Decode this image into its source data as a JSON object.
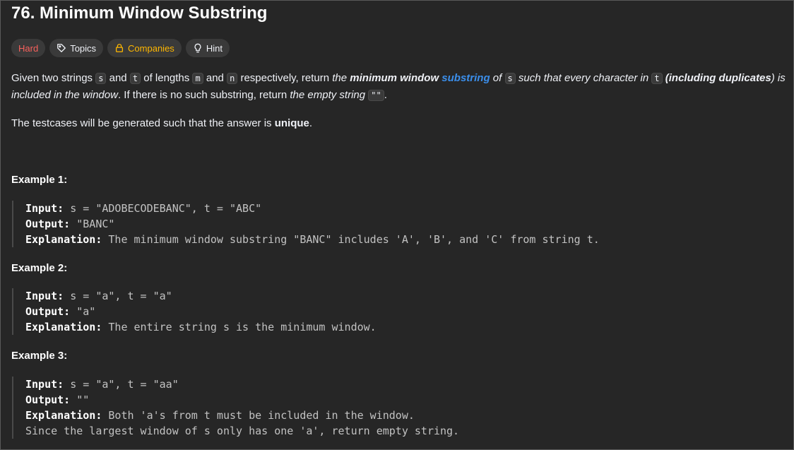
{
  "problem": {
    "title": "76. Minimum Window Substring"
  },
  "tags": {
    "difficulty": "Hard",
    "topics": "Topics",
    "companies": "Companies",
    "hint": "Hint"
  },
  "description": {
    "p1_a": "Given two strings ",
    "p1_s": "s",
    "p1_b": " and ",
    "p1_t": "t",
    "p1_c": " of lengths ",
    "p1_m": "m",
    "p1_d": " and ",
    "p1_n": "n",
    "p1_e": " respectively, return ",
    "p1_f": "the ",
    "p1_g": "minimum window",
    "p1_link": "substring",
    "p1_h": " of ",
    "p1_s2": "s",
    "p1_i": " such that every character in ",
    "p1_t2": "t",
    "p1_j": " (",
    "p1_k": "including duplicates",
    "p1_l": ") is included in the window",
    "p1_o": ". If there is no such substring, return ",
    "p1_p": "the empty string ",
    "p1_q": "\"\"",
    "p1_r": ".",
    "p2_a": "The testcases will be generated such that the answer is ",
    "p2_b": "unique",
    "p2_c": "."
  },
  "examples": [
    {
      "heading": "Example 1:",
      "input_label": "Input:",
      "input": " s = \"ADOBECODEBANC\", t = \"ABC\"",
      "output_label": "Output:",
      "output": " \"BANC\"",
      "explanation_label": "Explanation:",
      "explanation": " The minimum window substring \"BANC\" includes 'A', 'B', and 'C' from string t.",
      "explanation_2": ""
    },
    {
      "heading": "Example 2:",
      "input_label": "Input:",
      "input": " s = \"a\", t = \"a\"",
      "output_label": "Output:",
      "output": " \"a\"",
      "explanation_label": "Explanation:",
      "explanation": " The entire string s is the minimum window.",
      "explanation_2": ""
    },
    {
      "heading": "Example 3:",
      "input_label": "Input:",
      "input": " s = \"a\", t = \"aa\"",
      "output_label": "Output:",
      "output": " \"\"",
      "explanation_label": "Explanation:",
      "explanation": " Both 'a's from t must be included in the window.",
      "explanation_2": "Since the largest window of s only has one 'a', return empty string."
    }
  ],
  "colors": {
    "background": "#262626",
    "hard": "#f8615c",
    "companies": "#ffb700",
    "link": "#3b8eea"
  }
}
